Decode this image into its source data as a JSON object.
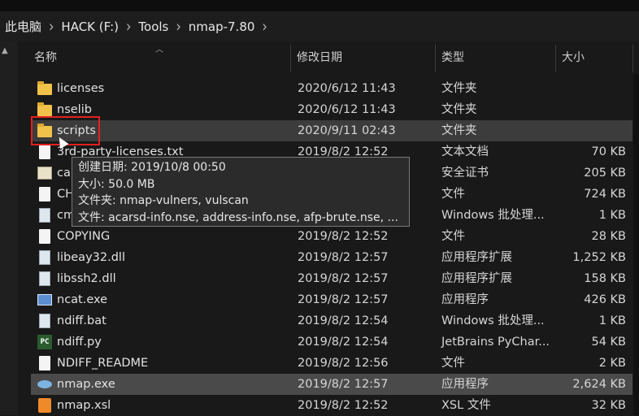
{
  "breadcrumb": [
    "此电脑",
    "HACK (F:)",
    "Tools",
    "nmap-7.80"
  ],
  "breadcrumb_sep": "›",
  "columns": {
    "name": "名称",
    "date": "修改日期",
    "type": "类型",
    "size": "大小"
  },
  "files": [
    {
      "name": "licenses",
      "date": "2020/6/12 11:43",
      "type": "文件夹",
      "size": "",
      "icon": "folder-icon"
    },
    {
      "name": "nselib",
      "date": "2020/6/12 11:43",
      "type": "文件夹",
      "size": "",
      "icon": "folder-icon"
    },
    {
      "name": "scripts",
      "date": "2020/9/11 02:43",
      "type": "文件夹",
      "size": "",
      "icon": "folder-icon"
    },
    {
      "name": "3rd-party-licenses.txt",
      "date": "2019/8/2 12:52",
      "type": "文本文档",
      "size": "70 KB",
      "icon": "text-file-icon"
    },
    {
      "name": "ca",
      "date": "",
      "type": "安全证书",
      "size": "205 KB",
      "icon": "certificate-icon"
    },
    {
      "name": "CH",
      "date": "",
      "type": "文件",
      "size": "724 KB",
      "icon": "file-icon"
    },
    {
      "name": "cm",
      "date": "",
      "type": "Windows 批处理...",
      "size": "1 KB",
      "icon": "batch-file-icon"
    },
    {
      "name": "COPYING",
      "date": "2019/8/2 12:52",
      "type": "文件",
      "size": "28 KB",
      "icon": "file-icon"
    },
    {
      "name": "libeay32.dll",
      "date": "2019/8/2 12:57",
      "type": "应用程序扩展",
      "size": "1,252 KB",
      "icon": "dll-icon"
    },
    {
      "name": "libssh2.dll",
      "date": "2019/8/2 12:57",
      "type": "应用程序扩展",
      "size": "158 KB",
      "icon": "dll-icon"
    },
    {
      "name": "ncat.exe",
      "date": "2019/8/2 12:57",
      "type": "应用程序",
      "size": "426 KB",
      "icon": "exe-icon"
    },
    {
      "name": "ndiff.bat",
      "date": "2019/8/2 12:54",
      "type": "Windows 批处理...",
      "size": "1 KB",
      "icon": "batch-file-icon"
    },
    {
      "name": "ndiff.py",
      "date": "2019/8/2 12:54",
      "type": "JetBrains PyChar...",
      "size": "54 KB",
      "icon": "pycharm-icon"
    },
    {
      "name": "NDIFF_README",
      "date": "2019/8/2 12:56",
      "type": "文件",
      "size": "2 KB",
      "icon": "file-icon"
    },
    {
      "name": "nmap.exe",
      "date": "2019/8/2 12:57",
      "type": "应用程序",
      "size": "2,624 KB",
      "icon": "nmap-eye-icon"
    },
    {
      "name": "nmap.xsl",
      "date": "2019/8/2 12:52",
      "type": "XSL 文件",
      "size": "32 KB",
      "icon": "xsl-icon"
    }
  ],
  "tooltip": {
    "created": "创建日期: 2019/10/8 00:50",
    "size": "大小: 50.0 MB",
    "folders": "文件夹: nmap-vulners, vulscan",
    "files": "文件: acarsd-info.nse, address-info.nse, afp-brute.nse, ..."
  }
}
